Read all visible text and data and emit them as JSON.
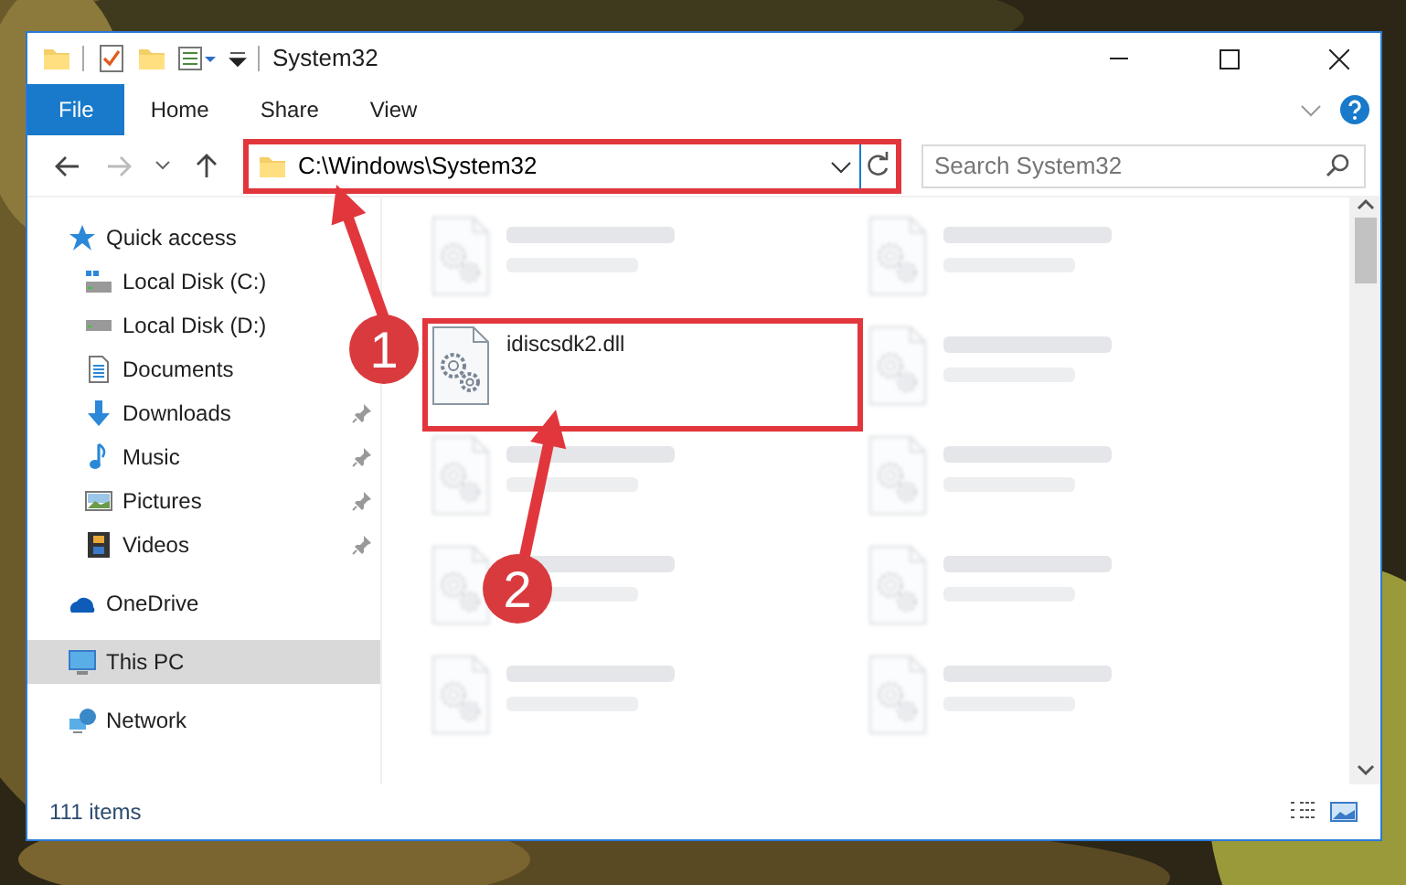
{
  "window": {
    "title": "System32"
  },
  "ribbon_tabs": [
    {
      "label": "File",
      "kind": "file"
    },
    {
      "label": "Home",
      "kind": "tab"
    },
    {
      "label": "Share",
      "kind": "tab"
    },
    {
      "label": "View",
      "kind": "tab"
    }
  ],
  "address": {
    "path": "C:\\Windows\\System32",
    "highlighted": true
  },
  "search": {
    "placeholder": "Search System32"
  },
  "sidebar": {
    "items": [
      {
        "label": "Quick access",
        "kind": "star",
        "selected": false,
        "children": [
          {
            "label": "Local Disk (C:)",
            "kind": "drive-c",
            "pinned": false,
            "selected": false
          },
          {
            "label": "Local Disk (D:)",
            "kind": "drive",
            "pinned": false,
            "selected": false
          },
          {
            "label": "Documents",
            "kind": "documents",
            "pinned": false,
            "selected": false
          },
          {
            "label": "Downloads",
            "kind": "downloads",
            "pinned": true,
            "selected": false
          },
          {
            "label": "Music",
            "kind": "music",
            "pinned": true,
            "selected": false
          },
          {
            "label": "Pictures",
            "kind": "pictures",
            "pinned": true,
            "selected": false
          },
          {
            "label": "Videos",
            "kind": "videos",
            "pinned": true,
            "selected": false
          }
        ]
      },
      {
        "label": "OneDrive",
        "kind": "cloud",
        "selected": false
      },
      {
        "label": "This PC",
        "kind": "pc",
        "selected": true
      },
      {
        "label": "Network",
        "kind": "network",
        "selected": false
      }
    ]
  },
  "files": [
    {
      "blurred": true,
      "highlighted": false
    },
    {
      "blurred": true,
      "highlighted": false
    },
    {
      "name": "idiscsdk2.dll",
      "blurred": false,
      "highlighted": true
    },
    {
      "blurred": true,
      "highlighted": false
    },
    {
      "blurred": true,
      "highlighted": false
    },
    {
      "blurred": true,
      "highlighted": false
    },
    {
      "blurred": true,
      "highlighted": false
    },
    {
      "blurred": true,
      "highlighted": false
    },
    {
      "blurred": true,
      "highlighted": false
    },
    {
      "blurred": true,
      "highlighted": false
    }
  ],
  "status_bar": {
    "item_count": "111 items"
  },
  "callouts": [
    {
      "label": "1"
    },
    {
      "label": "2"
    }
  ]
}
